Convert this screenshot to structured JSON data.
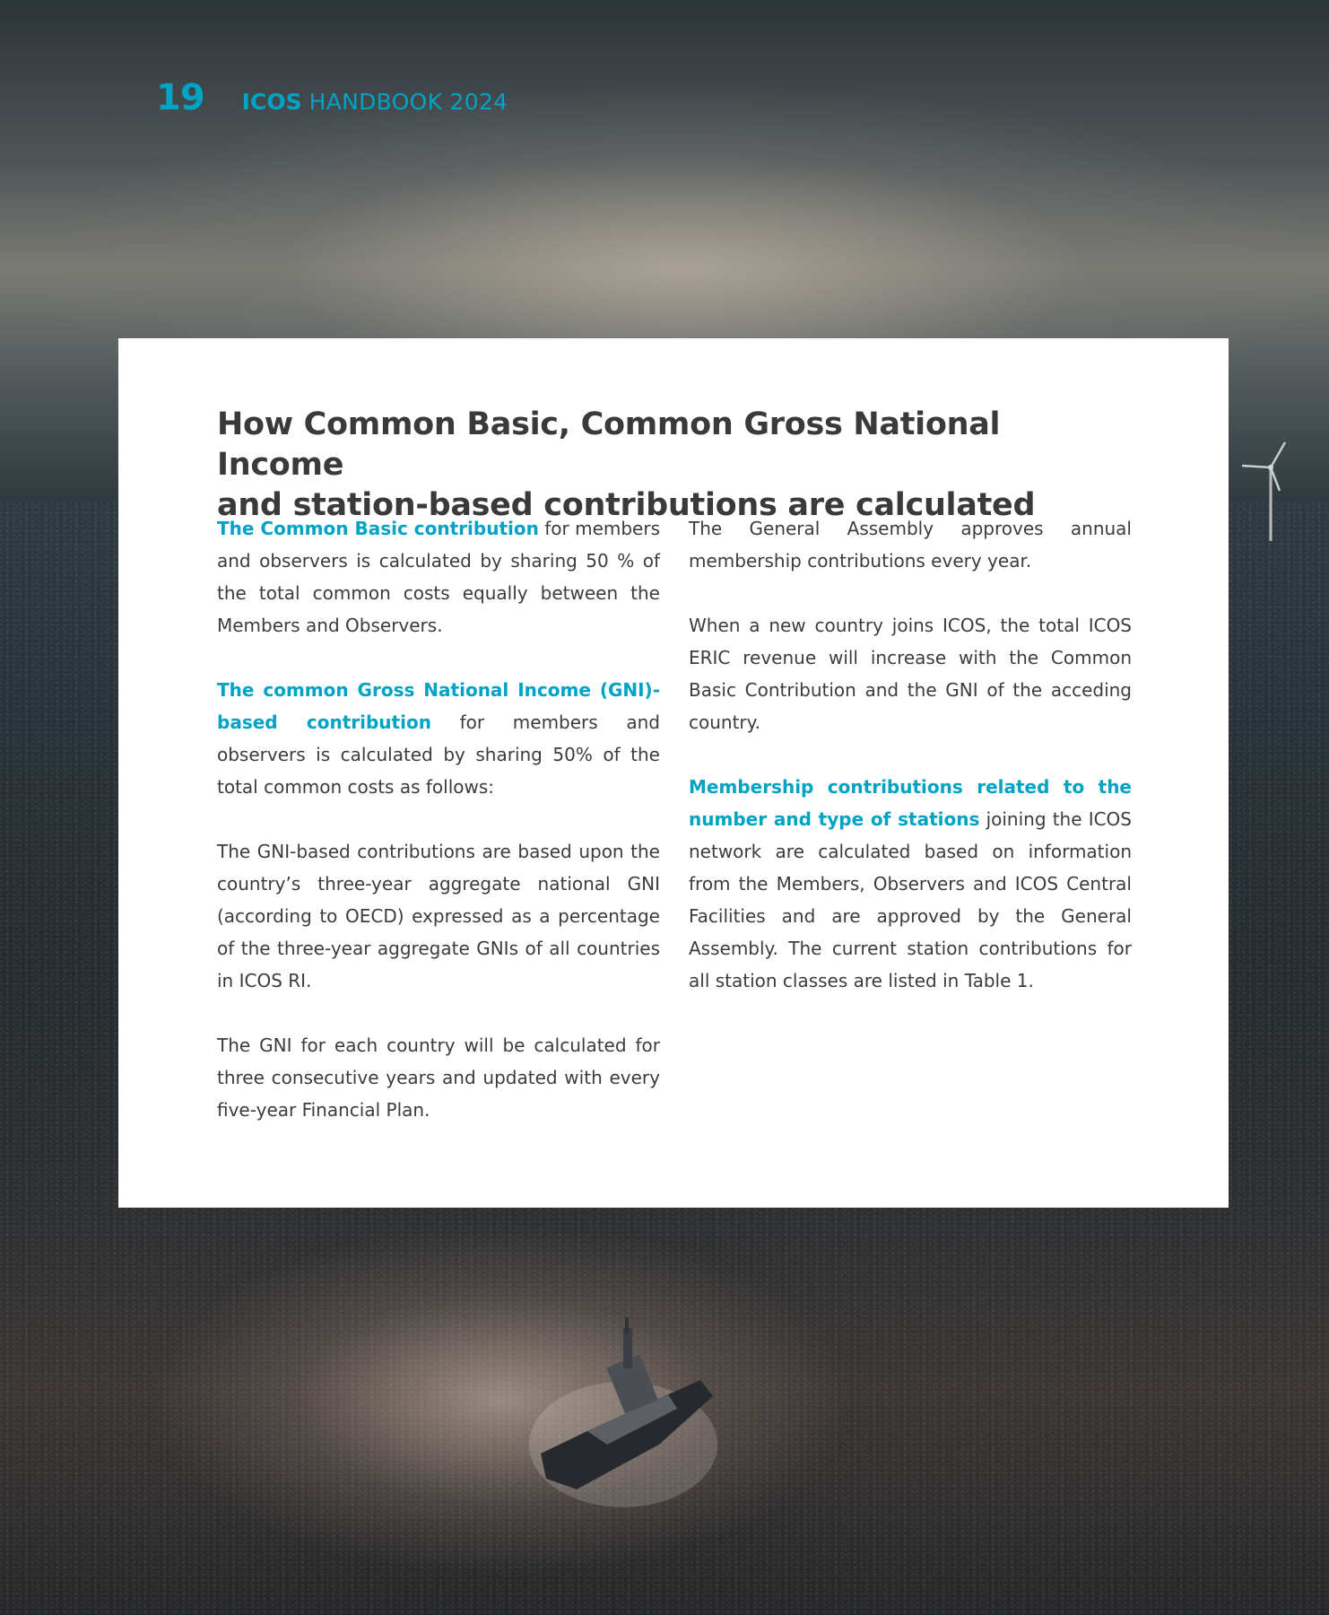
{
  "header": {
    "page_number": "19",
    "brand": "ICOS",
    "publication": "HANDBOOK 2024"
  },
  "colors": {
    "accent": "#00a3c4",
    "title_text": "#3a3a3a",
    "body_text": "#3c3c3c",
    "card_background": "#ffffff"
  },
  "card": {
    "title_line1": "How Common Basic, Common Gross National Income",
    "title_line2": "and station-based contributions are calculated",
    "left_column": [
      {
        "highlight": "The Common Basic contribution",
        "text": " for members and observers is calculated by sharing 50 % of the total common costs equally between the Members and Observers."
      },
      {
        "highlight": "The common Gross National Income (GNI)-based contribution",
        "text": " for members and observers is calculated by sharing 50% of the total common costs as follows:"
      },
      {
        "highlight": "",
        "text": "The GNI-based contributions are based upon the country’s three-year aggregate national GNI (according to OECD) expressed as a percentage of the three-year aggregate GNIs of all countries in ICOS RI."
      },
      {
        "highlight": "",
        "text": "The GNI for each country will be calculated for three consecutive years and updated with every five-year Financial Plan."
      }
    ],
    "right_column": [
      {
        "highlight": "",
        "text": "The General Assembly approves annual membership contributions every year."
      },
      {
        "highlight": "",
        "text": "When a new country joins ICOS, the total ICOS ERIC revenue will increase with the Common Basic Contribution and the GNI of the acceding country."
      },
      {
        "highlight": "Membership contributions related to the number and type of stations",
        "text": " joining the ICOS network are calculated based on information from the Members, Observers and ICOS Central Facilities and are approved by the General Assembly. The current station contributions for all station classes are listed in Table 1."
      }
    ]
  }
}
